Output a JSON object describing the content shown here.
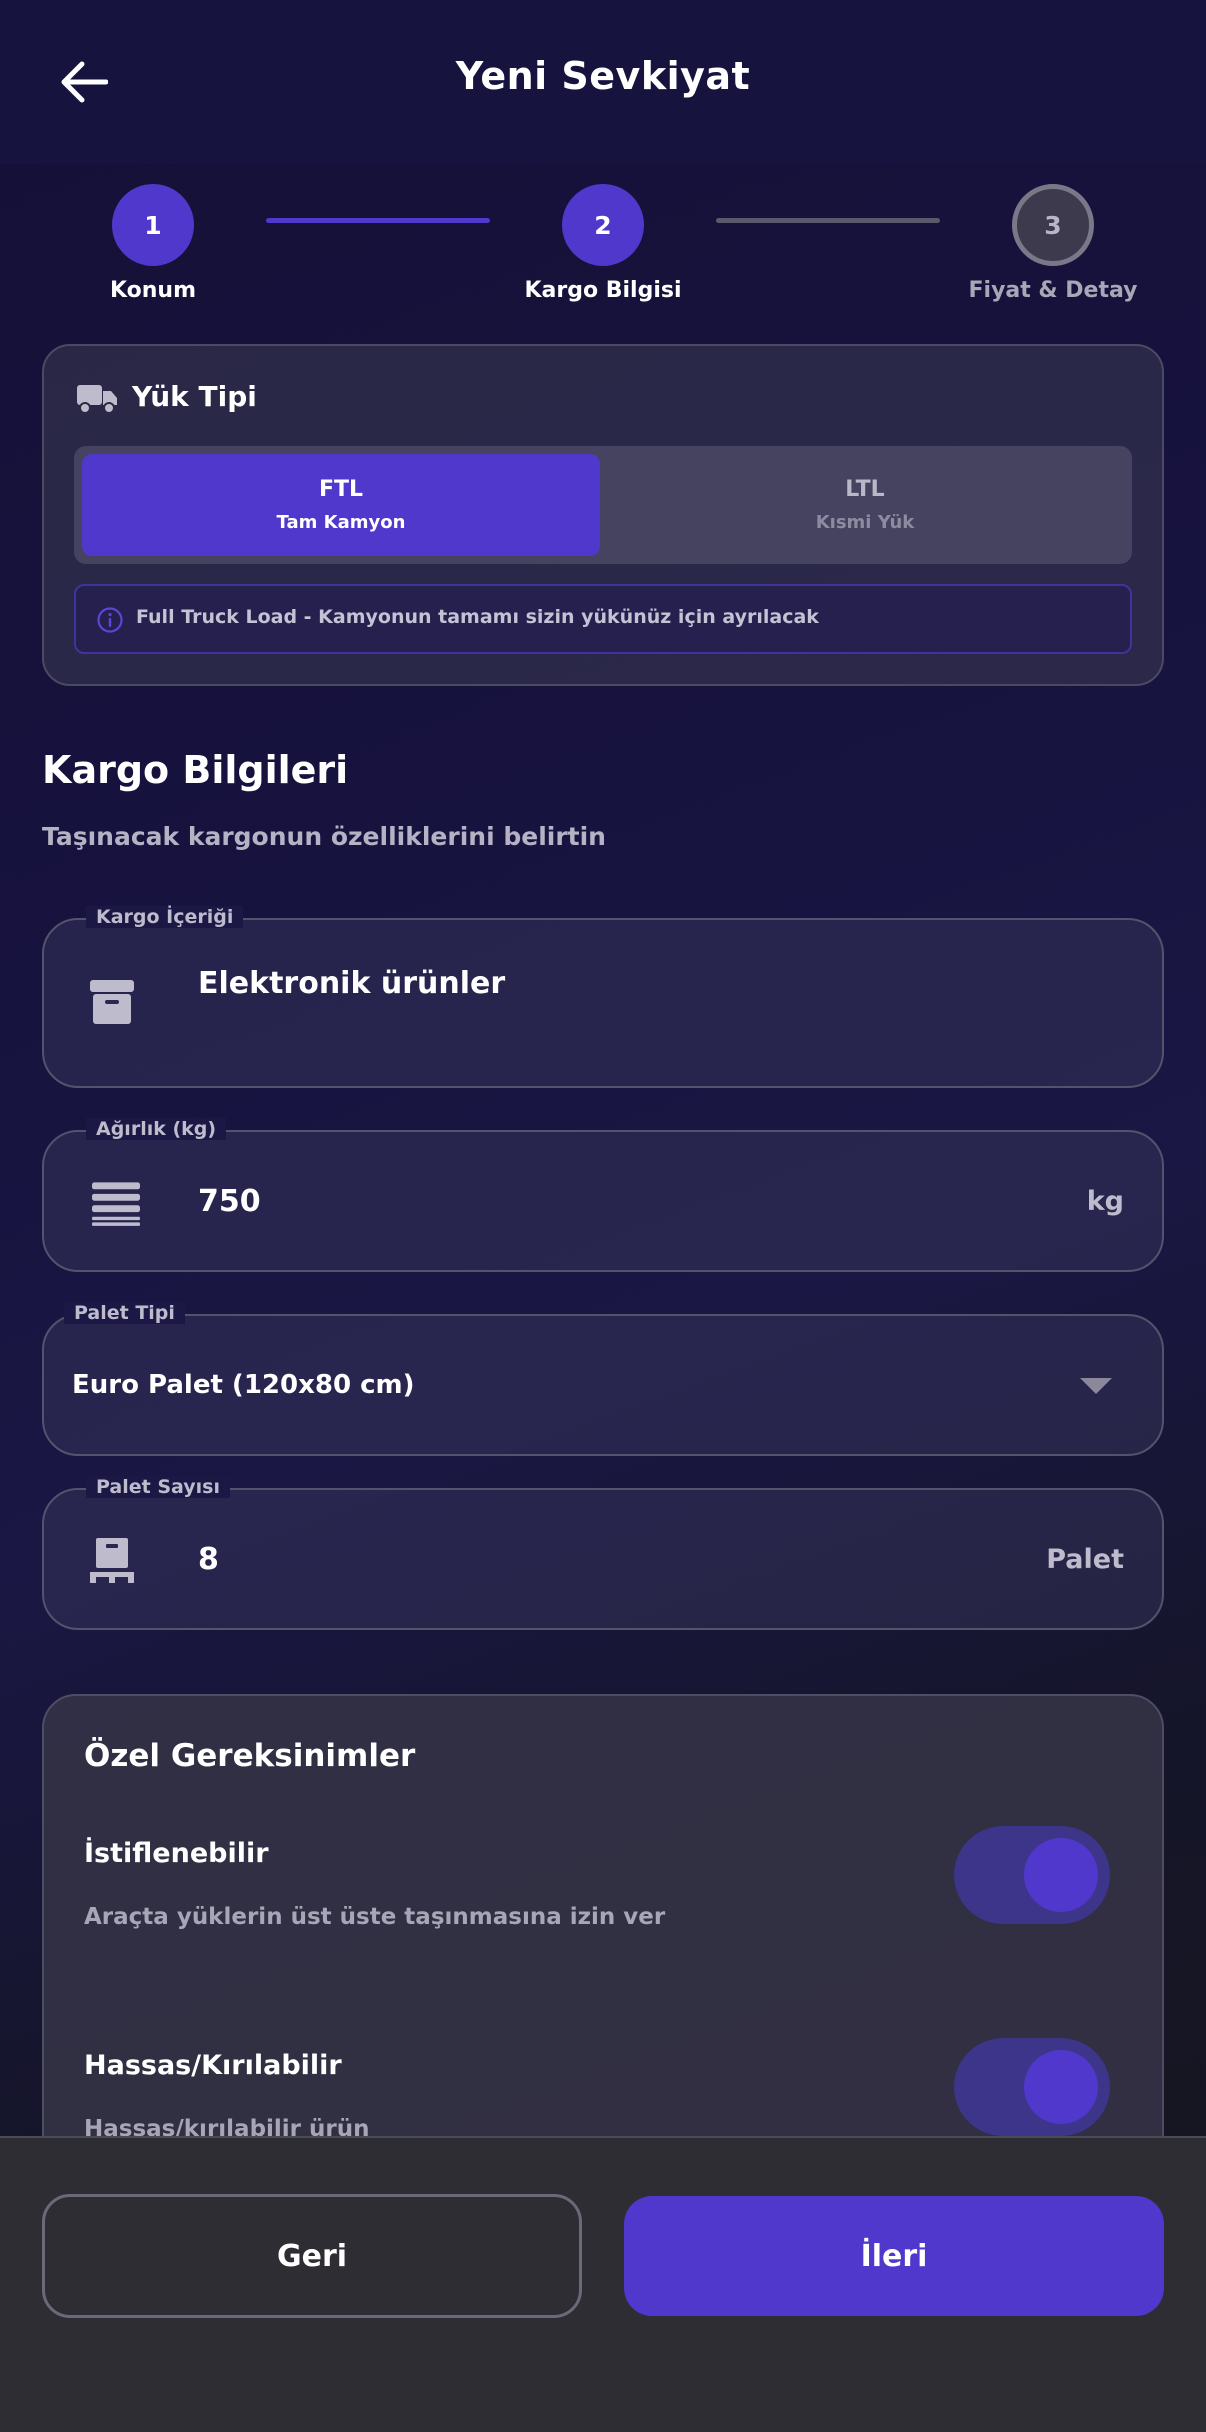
{
  "header": {
    "title": "Yeni Sevkiyat"
  },
  "stepper": {
    "steps": [
      {
        "number": "1",
        "label": "Konum",
        "state": "active"
      },
      {
        "number": "2",
        "label": "Kargo Bilgisi",
        "state": "active"
      },
      {
        "number": "3",
        "label": "Fiyat & Detay",
        "state": "pending"
      }
    ]
  },
  "load_type": {
    "title": "Yük Tipi",
    "options": [
      {
        "code": "FTL",
        "desc": "Tam Kamyon",
        "selected": true
      },
      {
        "code": "LTL",
        "desc": "Kısmi Yük",
        "selected": false
      }
    ],
    "info": "Full Truck Load - Kamyonun tamamı sizin yükünüz için ayrılacak"
  },
  "cargo": {
    "title": "Kargo Bilgileri",
    "subtitle": "Taşınacak kargonun özelliklerini belirtin",
    "content": {
      "label": "Kargo İçeriği",
      "value": "Elektronik ürünler"
    },
    "weight": {
      "label": "Ağırlık (kg)",
      "value": "750",
      "unit": "kg"
    },
    "pallet_type": {
      "label": "Palet Tipi",
      "value": "Euro Palet (120x80 cm)"
    },
    "pallet_count": {
      "label": "Palet Sayısı",
      "value": "8",
      "unit": "Palet"
    }
  },
  "requirements": {
    "title": "Özel Gereksinimler",
    "items": [
      {
        "title": "İstiflenebilir",
        "desc": "Araçta yüklerin üst üste taşınmasına izin ver",
        "enabled": true
      },
      {
        "title": "Hassas/Kırılabilir",
        "desc": "Hassas/kırılabilir ürün",
        "enabled": true
      }
    ]
  },
  "actions": {
    "back": "Geri",
    "next": "İleri"
  },
  "colors": {
    "accent": "#5138cc",
    "header_bg": "#17133f",
    "bottom_bar_bg": "#2e2d33",
    "pending_step": "#7a7888"
  }
}
